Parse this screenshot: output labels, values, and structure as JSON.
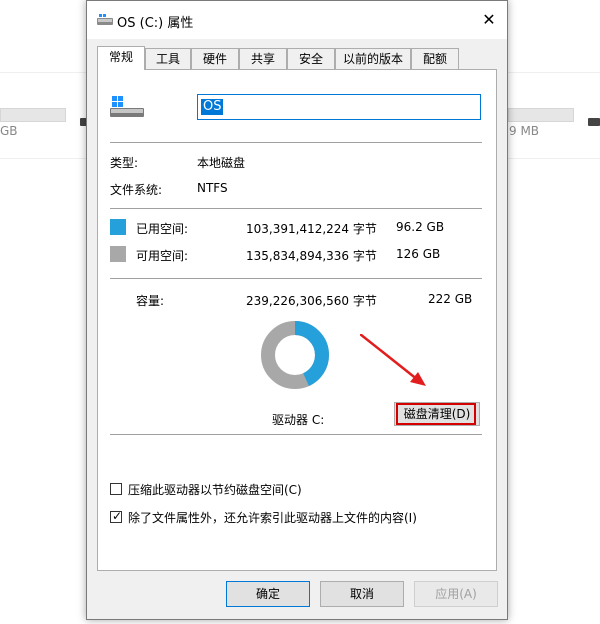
{
  "background": {
    "left_size": "GB",
    "right_size": "9 MB"
  },
  "dialog": {
    "title": "OS (C:) 属性",
    "close_glyph": "✕"
  },
  "tabs": [
    {
      "label": "常规",
      "active": true
    },
    {
      "label": "工具"
    },
    {
      "label": "硬件"
    },
    {
      "label": "共享"
    },
    {
      "label": "安全"
    },
    {
      "label": "以前的版本"
    },
    {
      "label": "配额"
    }
  ],
  "general": {
    "drive_name": "OS",
    "type_label": "类型:",
    "type_value": "本地磁盘",
    "fs_label": "文件系统:",
    "fs_value": "NTFS",
    "used": {
      "label": "已用空间:",
      "bytes": "103,391,412,224 字节",
      "size": "96.2 GB",
      "color": "#26a0da"
    },
    "free": {
      "label": "可用空间:",
      "bytes": "135,834,894,336 字节",
      "size": "126 GB",
      "color": "#a8a8a8"
    },
    "capacity": {
      "label": "容量:",
      "bytes": "239,226,306,560 字节",
      "size": "222 GB"
    },
    "drive_label": "驱动器 C:",
    "cleanup_button": "磁盘清理(D)",
    "used_fraction": 0.432
  },
  "options": {
    "compress_label": "压缩此驱动器以节约磁盘空间(C)",
    "compress_checked": false,
    "index_label": "除了文件属性外，还允许索引此驱动器上文件的内容(I)",
    "index_checked": true
  },
  "footer": {
    "ok": "确定",
    "cancel": "取消",
    "apply": "应用(A)"
  }
}
